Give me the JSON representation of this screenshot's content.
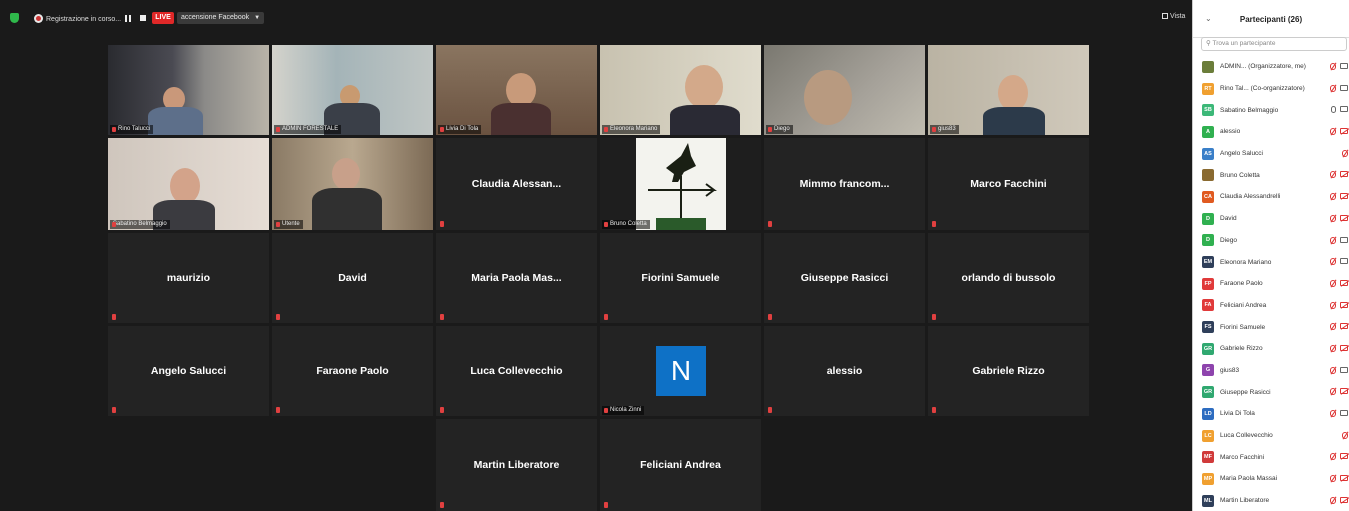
{
  "topbar": {
    "recording_label": "Registrazione in corso...",
    "live_label": "LIVE",
    "stream_label": "accensione Facebook",
    "view_label": "Vista"
  },
  "grid": {
    "row1": [
      "Rino Talucci",
      "ADMIN FORESTALE",
      "Livia Di Tola",
      "Eleonora Mariano",
      "Diego",
      "gius83"
    ],
    "row2": {
      "video1": "Sabatino Belmaggio",
      "video2": "Utente",
      "name3": "Claudia Alessan...",
      "logo_name": "Bruno Coletta",
      "name5": "Mimmo francom...",
      "name6": "Marco Facchini"
    },
    "row3": [
      "maurizio",
      "David",
      "Maria Paola Mas...",
      "Fiorini Samuele",
      "Giuseppe Rasicci",
      "orlando di bussolo"
    ],
    "row4": {
      "name1": "Angelo Salucci",
      "name2": "Faraone Paolo",
      "name3": "Luca Collevecchio",
      "avatar_letter": "N",
      "avatar_name": "Nicola Zinni",
      "name5": "alessio",
      "name6": "Gabriele Rizzo"
    },
    "row5": [
      "Martin Liberatore",
      "Feliciani Andrea"
    ]
  },
  "panel": {
    "title": "Partecipanti (26)",
    "search_placeholder": "Trova un partecipante",
    "participants": [
      {
        "initials": "",
        "name": "ADMIN... (Organizzatore, me)",
        "color": "#6b7d3a"
      },
      {
        "initials": "RT",
        "name": "Rino Tal... (Co-organizzatore)",
        "color": "#f0a030"
      },
      {
        "initials": "SB",
        "name": "Sabatino Belmaggio",
        "color": "#3cb878"
      },
      {
        "initials": "A",
        "name": "alessio",
        "color": "#30b050"
      },
      {
        "initials": "AS",
        "name": "Angelo Salucci",
        "color": "#3a7fc8"
      },
      {
        "initials": "",
        "name": "Bruno Coletta",
        "color": "#8a6a30"
      },
      {
        "initials": "CA",
        "name": "Claudia Alessandrelli",
        "color": "#e05a20"
      },
      {
        "initials": "D",
        "name": "David",
        "color": "#30b050"
      },
      {
        "initials": "D",
        "name": "Diego",
        "color": "#30b050"
      },
      {
        "initials": "EM",
        "name": "Eleonora Mariano",
        "color": "#2f3f5a"
      },
      {
        "initials": "FP",
        "name": "Faraone Paolo",
        "color": "#e03a3a"
      },
      {
        "initials": "FA",
        "name": "Feliciani Andrea",
        "color": "#e03a3a"
      },
      {
        "initials": "FS",
        "name": "Fiorini Samuele",
        "color": "#2f3f5a"
      },
      {
        "initials": "GR",
        "name": "Gabriele Rizzo",
        "color": "#30a870"
      },
      {
        "initials": "G",
        "name": "gius83",
        "color": "#8e44ad"
      },
      {
        "initials": "GR",
        "name": "Giuseppe Rasicci",
        "color": "#30a870"
      },
      {
        "initials": "LD",
        "name": "Livia Di Tola",
        "color": "#2d6cc0"
      },
      {
        "initials": "LC",
        "name": "Luca Collevecchio",
        "color": "#f0a030"
      },
      {
        "initials": "MF",
        "name": "Marco Facchini",
        "color": "#d03a3a"
      },
      {
        "initials": "MP",
        "name": "Maria Paola Massai",
        "color": "#f0a030"
      },
      {
        "initials": "ML",
        "name": "Martin Liberatore",
        "color": "#2f3f5a"
      }
    ]
  }
}
